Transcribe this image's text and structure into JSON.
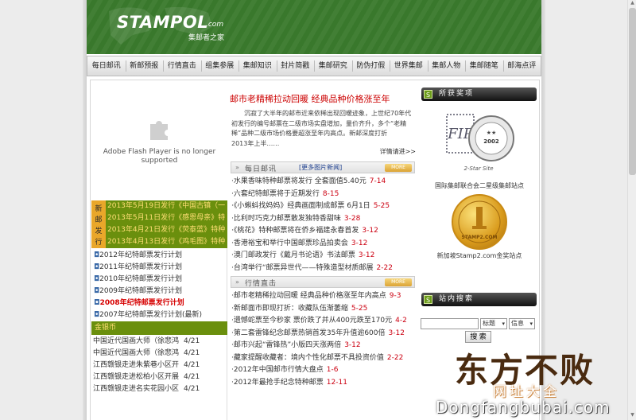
{
  "header": {
    "logo_text": "STAMPOL",
    "logo_com": ".com",
    "logo_sub": "集邮者之家"
  },
  "nav": [
    "每日邮讯",
    "新邮预报",
    "行情直击",
    "组集参展",
    "集邮知识",
    "封片简戳",
    "集邮研究",
    "防伪打假",
    "世界集邮",
    "集邮人物",
    "集邮随笔",
    "邮海点评"
  ],
  "flash": {
    "message": "Adobe Flash Player is no longer supported"
  },
  "new_issue": {
    "label": "新邮发行",
    "items": [
      "2013年5月19日发行《中国古镇（一",
      "2013年5月11日发行《感恩母亲》特",
      "2013年4月21日发行《荧泰蓝》特种",
      "2013年4月13日发行《鸡毛图》特种"
    ]
  },
  "plans": [
    {
      "text": "2012年纪特邮票发行计划",
      "highlight": false
    },
    {
      "text": "2011年纪特邮票发行计划",
      "highlight": false
    },
    {
      "text": "2010年纪特邮票发行计划",
      "highlight": false
    },
    {
      "text": "2009年纪特邮票发行计划",
      "highlight": false
    },
    {
      "text": "2008年纪特邮票发行计划",
      "highlight": true
    },
    {
      "text": "2007年纪特邮票发行计划(最新)",
      "highlight": false
    }
  ],
  "gold": {
    "header": "金银币",
    "items": [
      {
        "text": "中国近代国画大师（徐悲鸿",
        "date": "4/21"
      },
      {
        "text": "中国近代国画大师（徐悲鸿",
        "date": "4/21"
      },
      {
        "text": "江西赣银走进朱紫巷小区开",
        "date": "4/21"
      },
      {
        "text": "江西赣银走进松柏小区开展",
        "date": "4/21"
      },
      {
        "text": "江西赣银走进名实花园小区",
        "date": "4/21"
      }
    ]
  },
  "feature": {
    "title": "邮市老精稀拉动回暖 经典品种价格涨至年",
    "body": "沉寂了大半年的邮市近来依稀出现回暖迹象，上世纪70年代初发行的编号邮票在二级市场实盘增加，量价齐升，多个“老精稀”品种二级市场价格要超涨至年内高点。新邮深度打折　　2013年上半……",
    "more": "详情请进>>"
  },
  "daily": {
    "title": "每日邮讯",
    "link": "[更多图片新闻]",
    "more": "MORE",
    "items": [
      {
        "text": "·水果香味特种邮票将发行 全套面值5.40元",
        "date": "7-14"
      },
      {
        "text": "·六套纪特邮票将于近期发行",
        "date": "8-15"
      },
      {
        "text": "·《小蝌蚪找妈妈》经典画面制成邮票 6月1日",
        "date": "5-25"
      },
      {
        "text": "·比利时巧克力邮票散发独特香甜味",
        "date": "3-28"
      },
      {
        "text": "·《桃花》特种邮票将在侨乡福建永春首发",
        "date": "3-12"
      },
      {
        "text": "·香港裕宝和举行中国邮票珍品拍卖会",
        "date": "3-12"
      },
      {
        "text": "·澳门邮政发行《戴月书论语》书法邮票",
        "date": "3-12"
      },
      {
        "text": "·台湾举行“邮票异世代——特殊造型材质邮展",
        "date": "2-22"
      }
    ]
  },
  "market": {
    "title": "行情直击",
    "more": "MORE",
    "items": [
      {
        "text": "·邮市老精稀拉动回暖 经典品种价格涨至年内高点",
        "date": "9-3"
      },
      {
        "text": "·新邮面市即现打折：收藏队伍渐萎缩",
        "date": "5-25"
      },
      {
        "text": "·遗憾蛇票至今秒家 票价跌了并从400元跌至170元",
        "date": "4-2"
      },
      {
        "text": "·第二套雷锋纪念邮票热销首发35年升值逾600倍",
        "date": "3-12"
      },
      {
        "text": "·邮市兴起“雷锋热”小版四天涨两倍",
        "date": "3-12"
      },
      {
        "text": "·藏家提醒收藏者：境内个性化邮票不具投资价值",
        "date": "2-22"
      },
      {
        "text": "·2012年中国邮市行情大盘点",
        "date": "1-6"
      },
      {
        "text": "·2012年最抢手纪念特种邮票",
        "date": "12-11"
      }
    ]
  },
  "awards": {
    "header": "所获奖项",
    "icon_letter": "S",
    "award1_caption": "国际集邮联合会二星级集邮站点",
    "award2_caption": "新加坡Stamp2.com金奖站点",
    "award1_star_text": "2-Star Site",
    "award1_year": "2002",
    "award2_text": "STAMP2.COM"
  },
  "site_search": {
    "header": "站内搜索",
    "icon_letter": "S",
    "field_value": "",
    "select1": "标题",
    "select2": "信息",
    "button": "搜 索"
  },
  "watermark": {
    "big": "东方不败",
    "small": "网址大全",
    "url": "Dongfangbubai.com"
  },
  "colors": {
    "header_green": "#3a7a2d",
    "olive": "#6a8f0d",
    "orange_label": "#e9a72a",
    "title_red": "#cc0000",
    "link_blue": "#1a3c8c"
  }
}
